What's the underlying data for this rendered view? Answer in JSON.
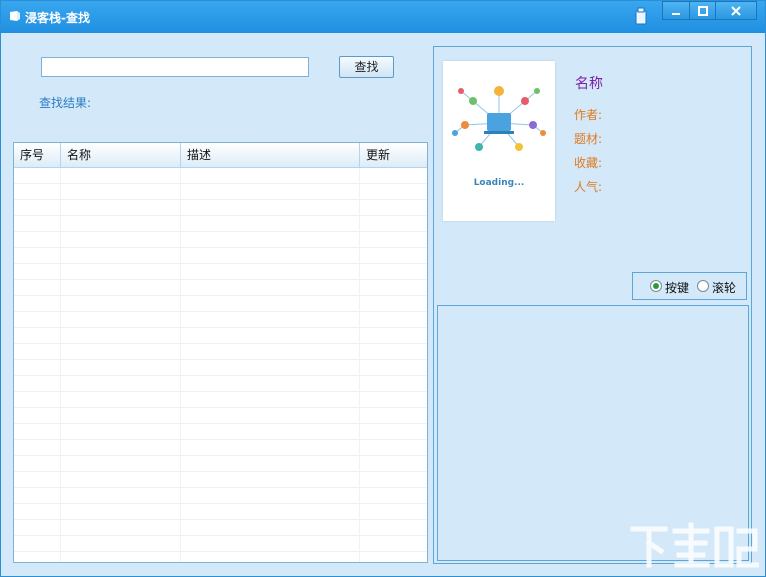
{
  "window": {
    "title": "浸客栈-查找"
  },
  "search": {
    "value": "",
    "placeholder": "",
    "button_label": "查找",
    "result_label": "查找结果:"
  },
  "table": {
    "headers": [
      "序号",
      "名称",
      "描述",
      "更新"
    ],
    "rows": []
  },
  "details": {
    "name": "名称",
    "author_label": "作者:",
    "theme_label": "题材:",
    "favorites_label": "收藏:",
    "popularity_label": "人气:",
    "thumbnail_loading": "Loading..."
  },
  "mode": {
    "options": [
      "按键",
      "滚轮"
    ],
    "selected": "按键"
  },
  "watermark": {
    "text": "下载吧"
  },
  "colors": {
    "titlebar": "#2b97e3",
    "accent": "#2a7cc4",
    "name": "#7a1ea6",
    "field": "#e07a1f"
  }
}
